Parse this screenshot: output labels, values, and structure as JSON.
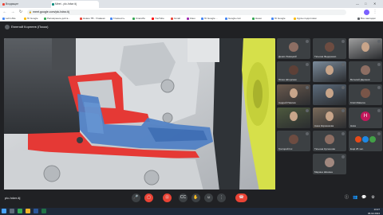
{
  "browser": {
    "tabs": [
      {
        "label": "Входящие",
        "active": false
      },
      {
        "label": "Meet - plc-hdwr-tij",
        "active": true
      }
    ],
    "address": "meet.google.com/plc-hdwr-tij",
    "bookmarks": [
      "Lehn:Alle",
      "Ю Google",
      "Расширение диста...",
      "Новое ТВ - Главная",
      "Гласность",
      "Спасибо",
      "YouTube",
      "Gmail",
      "Кино",
      "Ю Google ...",
      "Google.com",
      "Наши",
      "Ю Google",
      "Курсы подготовки",
      "Все закладки"
    ],
    "window_controls": [
      "—",
      "□",
      "✕"
    ]
  },
  "meet": {
    "presenter": "Евгений Корнеев (Показ)",
    "meeting_code": "plc-hdwr-tij",
    "participants": [
      {
        "name": "Денис Левицкий",
        "type": "avatar",
        "color": "#8d6e63"
      },
      {
        "name": "Татьяна Федоренко",
        "type": "avatar",
        "color": "#6d4c41"
      },
      {
        "name": "",
        "type": "camera",
        "color": "#9e9e9e"
      },
      {
        "name": "Юлия Шпорская",
        "type": "avatar",
        "color": "#5d4037"
      },
      {
        "name": "",
        "type": "camera",
        "color": "#7a8a9a"
      },
      {
        "name": "Виталий Дарянов",
        "type": "avatar",
        "color": "#8d6e63"
      },
      {
        "name": "Андрей Павлов",
        "type": "camera",
        "color": "#6b5a4e"
      },
      {
        "name": "",
        "type": "camera",
        "color": "#5b6a7a"
      },
      {
        "name": "Kristi Makarov",
        "type": "avatar",
        "color": "#795548"
      },
      {
        "name": "",
        "type": "camera",
        "color": "#4e5a3e"
      },
      {
        "name": "Анна Кириенкова",
        "type": "camera",
        "color": "#7a6a5a"
      },
      {
        "name": "Ника",
        "type": "letter",
        "letter": "Н",
        "color": "#c2185b"
      },
      {
        "name": "Григорий Inc",
        "type": "avatar",
        "color": "#6d4c41"
      },
      {
        "name": "Татьяна Кулешова",
        "type": "avatar",
        "color": "#8d6e63"
      },
      {
        "name": "Ещё 25 чел.",
        "type": "more",
        "color": "#3c4043"
      },
      {
        "name": "Марина Шонина",
        "type": "avatar",
        "color": "#a1887f"
      }
    ],
    "controls": {
      "more_count": "25"
    }
  },
  "taskbar": {
    "time": "13:27",
    "date": "06.02.2024"
  }
}
